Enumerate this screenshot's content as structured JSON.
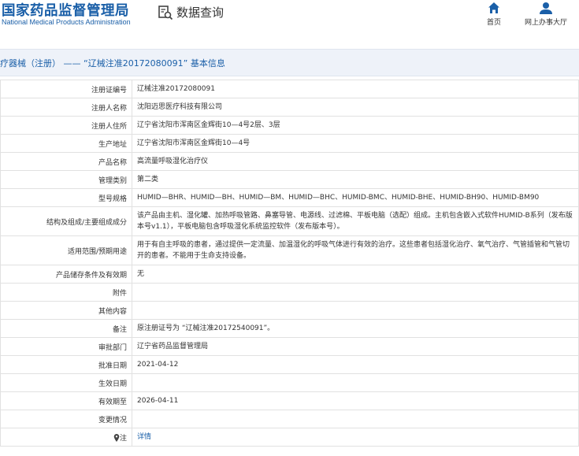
{
  "header": {
    "logo_cn": "国家药品监督管理局",
    "logo_en": "National Medical Products Administration",
    "query_title": "数据查询",
    "nav": [
      {
        "label": "首页",
        "icon": "home-icon"
      },
      {
        "label": "网上办事大厅",
        "icon": "user-icon"
      }
    ],
    "brand_color": "#1a5fa8"
  },
  "section": {
    "title": "疗器械（注册） —— “辽械注准20172080091” 基本信息"
  },
  "rows": [
    {
      "label": "注册证编号",
      "value": "辽械注准20172080091"
    },
    {
      "label": "注册人名称",
      "value": "沈阳迈思医疗科技有限公司"
    },
    {
      "label": "注册人住所",
      "value": "辽宁省沈阳市浑南区金辉街10—4号2层、3层"
    },
    {
      "label": "生产地址",
      "value": "辽宁省沈阳市浑南区金辉街10—4号"
    },
    {
      "label": "产品名称",
      "value": "高流量呼吸湿化治疗仪"
    },
    {
      "label": "管理类别",
      "value": "第二类"
    },
    {
      "label": "型号规格",
      "value": "HUMID—BHR、HUMID—BH、HUMID—BM、HUMID—BHC、HUMID-BMC、HUMID-BHE、HUMID-BH90、HUMID-BM90"
    },
    {
      "label": "结构及组成/主要组成成分",
      "value": "该产品由主机、湿化罐、加热呼吸管路、鼻塞导管、电源线、过滤棉、平板电脑（选配）组成。主机包含嵌入式软件HUMID-B系列（发布版本号v1.1），平板电脑包含呼吸湿化系统监控软件（发布版本号）。"
    },
    {
      "label": "适用范围/预期用途",
      "value": "用于有自主呼吸的患者，通过提供一定流量、加温湿化的呼吸气体进行有效的治疗。这些患者包括湿化治疗、氧气治疗、气管插管和气管切开的患者。不能用于生命支持设备。"
    },
    {
      "label": "产品储存条件及有效期",
      "value": "无"
    },
    {
      "label": "附件",
      "value": ""
    },
    {
      "label": "其他内容",
      "value": ""
    },
    {
      "label": "备注",
      "value": "原注册证号为 “辽械注准20172540091”。"
    },
    {
      "label": "审批部门",
      "value": "辽宁省药品监督管理局"
    },
    {
      "label": "批准日期",
      "value": "2021-04-12"
    },
    {
      "label": "生效日期",
      "value": ""
    },
    {
      "label": "有效期至",
      "value": "2026-04-11"
    },
    {
      "label": "变更情况",
      "value": ""
    },
    {
      "label": "注",
      "value": "详情"
    }
  ]
}
